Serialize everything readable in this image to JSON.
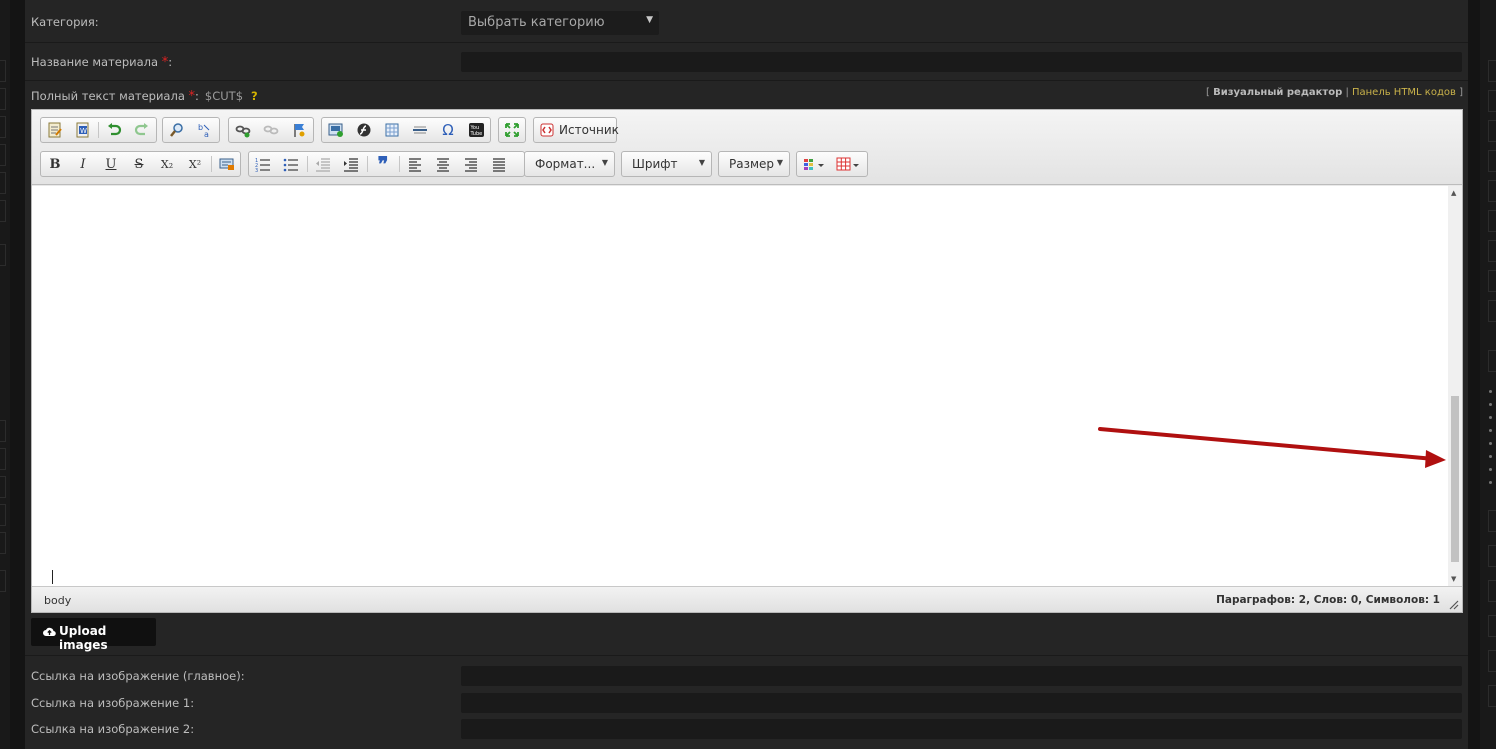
{
  "form": {
    "category_label": "Категория:",
    "category_select": "Выбрать категорию",
    "title_label": "Название материала",
    "required_mark": "*",
    "title_colon": ":",
    "fulltext_label": "Полный текст материала",
    "fulltext_colon": ":",
    "cut_tag": "$CUT$",
    "help_mark": "?",
    "mode_open": "[",
    "mode_visual": "Визуальный редактор",
    "mode_sep": "|",
    "mode_html": "Панель HTML кодов",
    "mode_close": "]"
  },
  "toolbar": {
    "source_label": "Источник",
    "format_label": "Формат...",
    "font_label": "Шрифт",
    "size_label": "Размер",
    "bold_glyph": "B",
    "italic_glyph": "I",
    "underline_glyph": "U",
    "strike_glyph": "S",
    "subscript_glyph": "X₂",
    "superscript_glyph": "X²",
    "special_char_glyph": "Ω",
    "youtube_glyph": "You Tube"
  },
  "editor": {
    "element_path": "body",
    "counts": "Параграфов: 2, Слов: 0, Символов: 1"
  },
  "upload": {
    "label": "Upload images"
  },
  "image_fields": {
    "main_label": "Ссылка на изображение (главное):",
    "img1_label": "Ссылка на изображение 1:",
    "img2_label": "Ссылка на изображение 2:"
  },
  "annotation": {
    "arrow_color": "#b01010"
  },
  "icons": [
    "paste-text-icon",
    "paste-word-icon",
    "undo-icon",
    "redo-icon",
    "find-icon",
    "replace-icon",
    "link-icon",
    "unlink-icon",
    "anchor-icon",
    "image-icon",
    "flash-icon",
    "table-icon",
    "horizontal-rule-icon",
    "special-char-icon",
    "youtube-icon",
    "maximize-icon",
    "source-icon",
    "remove-format-icon",
    "numbered-list-icon",
    "bulleted-list-icon",
    "outdent-icon",
    "indent-icon",
    "blockquote-icon",
    "align-left-icon",
    "align-center-icon",
    "align-right-icon",
    "align-justify-icon",
    "text-color-icon",
    "table-grid-icon",
    "upload-cloud-icon",
    "resize-grip-icon"
  ]
}
